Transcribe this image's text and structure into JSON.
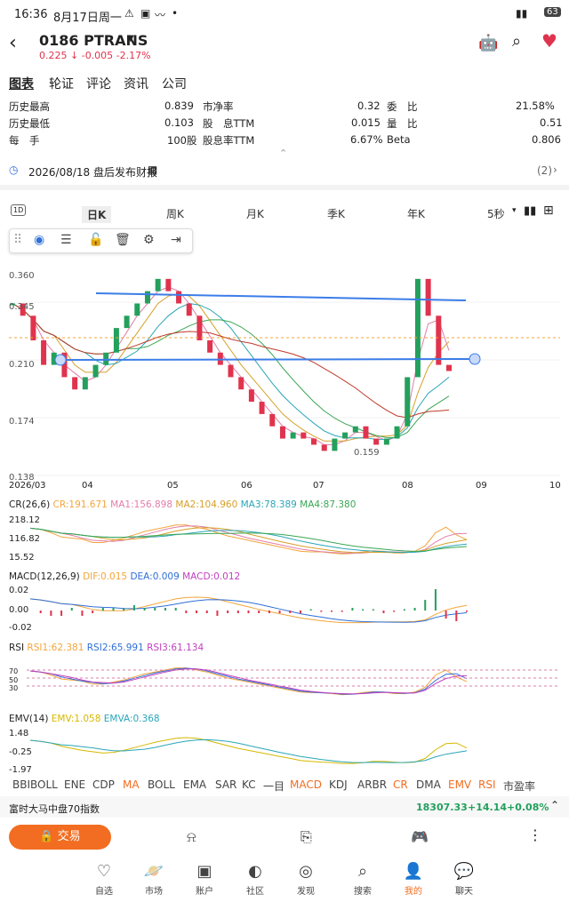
{
  "status_bar": {
    "time": "16:36",
    "date": "8月17日周一",
    "battery": "63"
  },
  "header": {
    "title": "0186 PTRANS",
    "price": "0.225",
    "change": "-0.005",
    "change_pct": "-2.17%"
  },
  "tabs": [
    "图表",
    "轮证",
    "评论",
    "资讯",
    "公司"
  ],
  "stats": [
    {
      "k": "历史最高",
      "v": "0.839",
      "k2": "市净率",
      "v2": "0.32",
      "k3": "委　比",
      "v3": "21.58%"
    },
    {
      "k": "历史最低",
      "v": "0.103",
      "k2": "股　息TTM",
      "v2": "0.015",
      "k3": "量　比",
      "v3": "0.51"
    },
    {
      "k": "每　手",
      "v": "100股",
      "k2": "股息率TTM",
      "v2": "6.67%",
      "k3": "Beta",
      "v3": "0.806"
    }
  ],
  "event": {
    "text": "2026/08/18 盘后发布财报",
    "count": "(2)"
  },
  "periods": [
    "日K",
    "周K",
    "月K",
    "季K",
    "年K",
    "5秒"
  ],
  "chart_data": {
    "type": "line",
    "price_axis": [
      "0.360",
      "0.345",
      "0.210",
      "0.174",
      "0.138"
    ],
    "x_ticks": [
      "2026/03",
      "04",
      "05",
      "06",
      "07",
      "08",
      "09",
      "10"
    ],
    "markers": [
      "0.159"
    ],
    "series": [
      {
        "name": "Close",
        "values": [
          0.28,
          0.27,
          0.25,
          0.23,
          0.24,
          0.22,
          0.21,
          0.22,
          0.23,
          0.24,
          0.26,
          0.27,
          0.28,
          0.29,
          0.3,
          0.29,
          0.28,
          0.27,
          0.25,
          0.24,
          0.23,
          0.22,
          0.21,
          0.2,
          0.19,
          0.18,
          0.17,
          0.175,
          0.17,
          0.165,
          0.16,
          0.17,
          0.175,
          0.18,
          0.17,
          0.165,
          0.17,
          0.18,
          0.22,
          0.3,
          0.27,
          0.23,
          0.225
        ]
      }
    ]
  },
  "indicators": {
    "cr": {
      "title": "CR(26,6)",
      "cr": "CR:191.671",
      "ma1": "MA1:156.898",
      "ma2": "MA2:104.960",
      "ma3": "MA3:78.389",
      "ma4": "MA4:87.380",
      "ticks": [
        "218.12",
        "116.82",
        "15.52"
      ]
    },
    "macd": {
      "title": "MACD(12,26,9)",
      "dif": "DIF:0.015",
      "dea": "DEA:0.009",
      "macd": "MACD:0.012",
      "ticks": [
        "0.02",
        "0.00",
        "-0.02"
      ]
    },
    "rsi": {
      "title": "RSI",
      "r1": "RSI1:62.381",
      "r2": "RSI2:65.991",
      "r3": "RSI3:61.134",
      "ticks": [
        "70",
        "50",
        "30"
      ]
    },
    "emv": {
      "title": "EMV(14)",
      "emv": "EMV:1.058",
      "emva": "EMVA:0.368",
      "ticks": [
        "1.48",
        "-0.25",
        "-1.97"
      ]
    }
  },
  "indicator_tabs": [
    "BBIBOLL",
    "ENE",
    "CDP",
    "MA",
    "BOLL",
    "EMA",
    "SAR",
    "KC",
    "一目",
    "MACD",
    "KDJ",
    "ARBR",
    "CR",
    "DMA",
    "EMV",
    "RSI",
    "市盈率"
  ],
  "market": {
    "name": "富时大马中盘70指数",
    "value": "18307.33",
    "change": "+14.14",
    "pct": "+0.08%"
  },
  "trade_label": "交易",
  "nav": [
    "自选",
    "市场",
    "账户",
    "社区",
    "发现",
    "搜索",
    "我的",
    "聊天"
  ]
}
